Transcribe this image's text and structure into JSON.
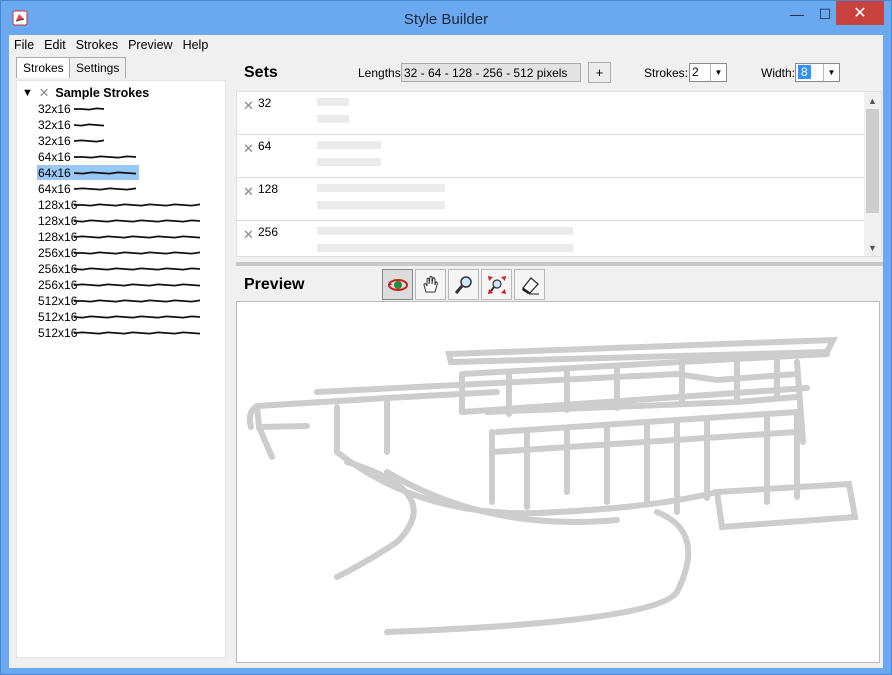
{
  "window": {
    "title": "Style Builder",
    "minimize": "—",
    "maximize": "☐",
    "close": "✕"
  },
  "menu": [
    "File",
    "Edit",
    "Strokes",
    "Preview",
    "Help"
  ],
  "tabs": {
    "strokes": "Strokes",
    "settings": "Settings"
  },
  "tree": {
    "root_label": "Sample Strokes",
    "items": [
      "32x16",
      "32x16",
      "32x16",
      "64x16",
      "64x16",
      "64x16",
      "128x16",
      "128x16",
      "128x16",
      "256x16",
      "256x16",
      "256x16",
      "512x16",
      "512x16",
      "512x16"
    ],
    "selected_index": 4
  },
  "sets": {
    "title": "Sets",
    "lengths_label": "Lengths:",
    "lengths_value": "32 - 64 - 128 - 256 - 512 pixels",
    "plus_label": "+",
    "strokes_label": "Strokes:",
    "strokes_value": "2",
    "width_label": "Width:",
    "width_value": "8",
    "rows": [
      "32",
      "64",
      "128",
      "256"
    ]
  },
  "preview": {
    "title": "Preview"
  },
  "icons": {
    "tools": [
      "orbit-icon",
      "pan-icon",
      "zoom-icon",
      "zoom-extents-icon",
      "eraser-icon"
    ]
  }
}
